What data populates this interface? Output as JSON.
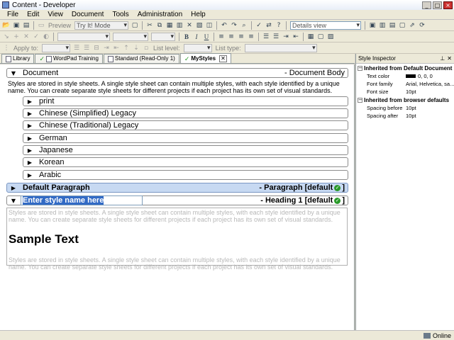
{
  "window": {
    "title": "Content - Developer"
  },
  "menu": [
    "File",
    "Edit",
    "View",
    "Document",
    "Tools",
    "Administration",
    "Help"
  ],
  "toolbar": {
    "preview_label": "Preview",
    "mode_value": "Try It! Mode",
    "view_value": "Details view"
  },
  "toolbar3": {
    "apply_to_label": "Apply to:",
    "list_level_label": "List level:",
    "list_type_label": "List type:"
  },
  "tabs": [
    {
      "label": "Library"
    },
    {
      "label": "WordPad Training"
    },
    {
      "label": "Standard (Read-Only 1)"
    },
    {
      "label": "MyStyles"
    }
  ],
  "editor": {
    "document_row": {
      "name": "Document",
      "right": "- Document Body"
    },
    "description": "Styles are stored in style sheets. A single style sheet can contain multiple styles, with each style identified by a unique name. You can create separate style sheets for different projects if each project has its own set of visual standards.",
    "children": [
      "print",
      "Chinese (Simplified) Legacy",
      "Chinese (Traditional) Legacy",
      "German",
      "Japanese",
      "Korean",
      "Arabic"
    ],
    "paragraph_row": {
      "name": "Default Paragraph",
      "right": "- Paragraph [default",
      "right_end": "]"
    },
    "heading_row": {
      "right": "- Heading 1 [default",
      "right_end": "]"
    },
    "name_input_value": "Enter style name here",
    "preview": {
      "text": "Styles are stored in style sheets. A single style sheet can contain multiple styles, with each style identified by a unique name. You can create separate style sheets for different projects if each project has its own set of visual standards.",
      "sample": "Sample Text"
    }
  },
  "inspector": {
    "title": "Style Inspector",
    "section1": "Inherited from Default Document Bo",
    "rows1": [
      {
        "k": "Text color",
        "v": "0, 0, 0"
      },
      {
        "k": "Font family",
        "v": "Arial, Helvetica, sa..."
      },
      {
        "k": "Font size",
        "v": "10pt"
      }
    ],
    "section2": "Inherited from browser defaults",
    "rows2": [
      {
        "k": "Spacing before",
        "v": "10pt"
      },
      {
        "k": "Spacing after",
        "v": "10pt"
      }
    ]
  },
  "status": {
    "text": "Online"
  }
}
